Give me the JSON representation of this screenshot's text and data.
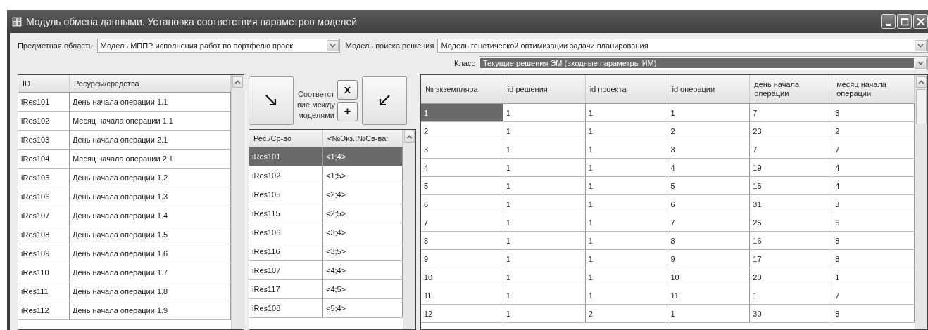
{
  "window": {
    "title": "Модуль обмена данными. Установка соответствия параметров моделей"
  },
  "filters": {
    "subject_area": {
      "label": "Предметная область",
      "value": "Модель МППР исполнения работ по портфелю проек"
    },
    "search_model": {
      "label": "Модель поиска решения",
      "value": "Модель генетической оптимизации задачи планирования"
    },
    "class": {
      "label": "Класс",
      "value": "Текущие решения ЭМ (входные параметры ИМ)",
      "selected": true
    }
  },
  "resources": {
    "columns": [
      "ID",
      "Ресурсы/средства"
    ],
    "rows": [
      {
        "id": "iRes101",
        "name": "День начала операции 1.1"
      },
      {
        "id": "iRes102",
        "name": "Месяц начала операции 1.1"
      },
      {
        "id": "iRes103",
        "name": "День начала операции 2.1"
      },
      {
        "id": "iRes104",
        "name": "Месяц начала операции 2.1"
      },
      {
        "id": "iRes105",
        "name": "День начала операции 1.2"
      },
      {
        "id": "iRes106",
        "name": "День начала операции 1.3"
      },
      {
        "id": "iRes107",
        "name": "День начала операции 1.4"
      },
      {
        "id": "iRes108",
        "name": "День начала операции 1.5"
      },
      {
        "id": "iRes109",
        "name": "День начала операции 1.6"
      },
      {
        "id": "iRes110",
        "name": "День начала операции 1.7"
      },
      {
        "id": "iRes111",
        "name": "День начала операции 1.8"
      },
      {
        "id": "iRes112",
        "name": "День начала операции 1.9"
      }
    ]
  },
  "mapping": {
    "caption": "Соответствие между моделями",
    "remove_button": "x",
    "add_button": "+",
    "columns": [
      "Рес./Ср-во",
      "<№Экз.;№Св-ва:"
    ],
    "rows": [
      {
        "resource": "iRes101",
        "pair": "<1;4>",
        "selected": true
      },
      {
        "resource": "iRes102",
        "pair": "<1;5>",
        "selected": false
      },
      {
        "resource": "iRes105",
        "pair": "<2;4>",
        "selected": false
      },
      {
        "resource": "iRes115",
        "pair": "<2;5>",
        "selected": false
      },
      {
        "resource": "iRes106",
        "pair": "<3;4>",
        "selected": false
      },
      {
        "resource": "iRes116",
        "pair": "<3;5>",
        "selected": false
      },
      {
        "resource": "iRes107",
        "pair": "<4;4>",
        "selected": false
      },
      {
        "resource": "iRes117",
        "pair": "<4;5>",
        "selected": false
      },
      {
        "resource": "iRes108",
        "pair": "<5;4>",
        "selected": false
      }
    ]
  },
  "instances": {
    "columns": [
      "№ экземпляра",
      "id решения",
      "id проекта",
      "id операции",
      "день начала операции",
      "месяц начала операции"
    ],
    "rows": [
      {
        "cells": [
          "1",
          "1",
          "1",
          "1",
          "7",
          "3"
        ],
        "selected": true
      },
      {
        "cells": [
          "2",
          "1",
          "1",
          "2",
          "23",
          "2"
        ],
        "selected": false
      },
      {
        "cells": [
          "3",
          "1",
          "1",
          "3",
          "7",
          "7"
        ],
        "selected": false
      },
      {
        "cells": [
          "4",
          "1",
          "1",
          "4",
          "19",
          "4"
        ],
        "selected": false
      },
      {
        "cells": [
          "5",
          "1",
          "1",
          "5",
          "15",
          "4"
        ],
        "selected": false
      },
      {
        "cells": [
          "6",
          "1",
          "1",
          "6",
          "31",
          "3"
        ],
        "selected": false
      },
      {
        "cells": [
          "7",
          "1",
          "1",
          "7",
          "25",
          "6"
        ],
        "selected": false
      },
      {
        "cells": [
          "8",
          "1",
          "1",
          "8",
          "16",
          "8"
        ],
        "selected": false
      },
      {
        "cells": [
          "9",
          "1",
          "1",
          "9",
          "17",
          "8"
        ],
        "selected": false
      },
      {
        "cells": [
          "10",
          "1",
          "1",
          "10",
          "20",
          "1"
        ],
        "selected": false
      },
      {
        "cells": [
          "11",
          "1",
          "1",
          "11",
          "1",
          "7"
        ],
        "selected": false
      },
      {
        "cells": [
          "12",
          "1",
          "2",
          "1",
          "30",
          "8"
        ],
        "selected": false
      }
    ]
  }
}
